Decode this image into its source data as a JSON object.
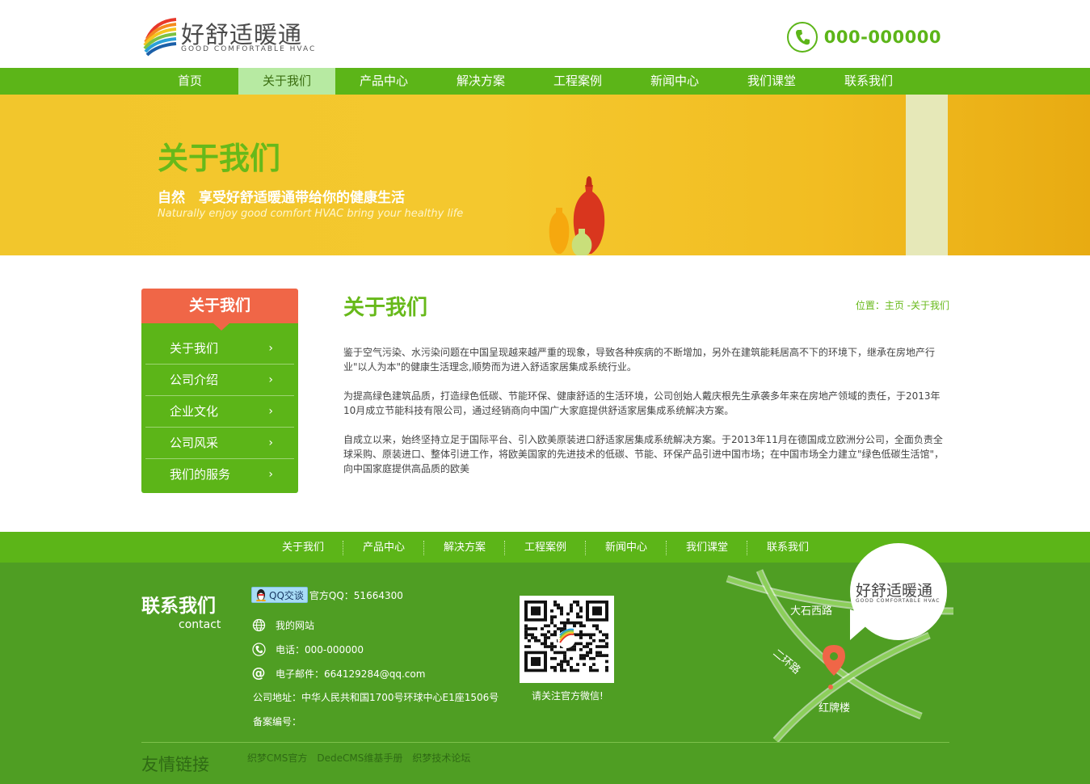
{
  "header": {
    "logo_cn": "好舒适暖通",
    "logo_en": "GOOD COMFORTABLE HVAC",
    "phone": "000-000000"
  },
  "nav": {
    "items": [
      "首页",
      "关于我们",
      "产品中心",
      "解决方案",
      "工程案例",
      "新闻中心",
      "我们课堂",
      "联系我们"
    ],
    "active_index": 1
  },
  "banner": {
    "title": "关于我们",
    "subtitle": "自然　享受好舒适暖通带给你的健康生活",
    "subtitle_en": "Naturally enjoy good comfort HVAC bring your healthy life"
  },
  "sidebar": {
    "title": "关于我们",
    "items": [
      "关于我们",
      "公司介绍",
      "企业文化",
      "公司风采",
      "我们的服务"
    ],
    "arrow": "›"
  },
  "main": {
    "title": "关于我们",
    "breadcrumb": "位置：主页 -关于我们",
    "paragraphs": [
      " 鉴于空气污染、水污染问题在中国呈现越来越严重的现象，导致各种疾病的不断增加，另外在建筑能耗居高不下的环境下，继承在房地产行业\"以人为本\"的健康生活理念,顺势而为进入舒适家居集成系统行业。",
      "为提高绿色建筑品质，打造绿色低碳、节能环保、健康舒适的生活环境，公司创始人戴庆根先生承袭多年来在房地产领域的责任，于2013年10月成立节能科技有限公司，通过经销商向中国广大家庭提供舒适家居集成系统解决方案。",
      "自成立以来，始终坚持立足于国际平台、引入欧美原装进口舒适家居集成系统解决方案。于2013年11月在德国成立欧洲分公司，全面负责全球采购、原装进口、整体引进工作，将欧美国家的先进技术的低碳、节能、环保产品引进中国市场；在中国市场全力建立\"绿色低碳生活馆\"，向中国家庭提供高品质的欧美"
    ]
  },
  "footer_nav": {
    "items": [
      "关于我们",
      "产品中心",
      "解决方案",
      "工程案例",
      "新闻中心",
      "我们课堂",
      "联系我们"
    ]
  },
  "footer": {
    "contact_cn": "联系我们",
    "contact_en": "contact",
    "qq_button": "QQ交谈",
    "qq_text": "官方QQ：51664300",
    "website": "我的网站",
    "phone": "电话：000-000000",
    "email": "电子邮件：664129284@qq.com",
    "address": "公司地址：中华人民共和国1700号环球中心E1座1506号",
    "icp": "备案编号：",
    "qr_caption": "请关注官方微信!",
    "links_title": "友情链接",
    "links": [
      "织梦CMS官方",
      "DedeCMS维基手册",
      "织梦技术论坛"
    ],
    "map_logo_cn": "好舒适暖通",
    "map_logo_en": "GOOD COMFORTABLE HVAC",
    "roads": [
      "大石西路",
      "二环路",
      "红牌楼"
    ]
  },
  "colors": {
    "green": "#5cb518",
    "green_dark": "#4f9e23",
    "orange": "#f06647",
    "yellow": "#f2c62c"
  }
}
